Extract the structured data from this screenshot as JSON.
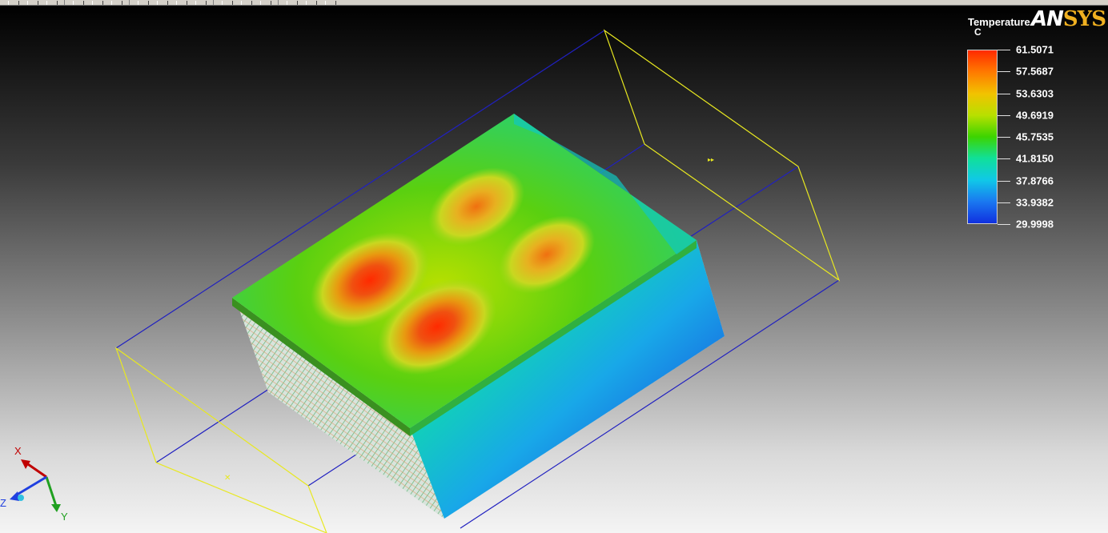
{
  "app": {
    "logo_prefix": "AN",
    "logo_suffix": "SYS",
    "brand_accent": "#f0b020"
  },
  "legend": {
    "title": "Temperature",
    "unit": "C",
    "labels": [
      "61.5071",
      "57.5687",
      "53.6303",
      "49.6919",
      "45.7535",
      "41.8150",
      "37.8766",
      "33.9382",
      "29.9998"
    ],
    "colors": [
      "#ff2a00",
      "#ff7a00",
      "#f2c200",
      "#b8e000",
      "#3cd400",
      "#10e09a",
      "#10c8e8",
      "#1a78f0",
      "#1030e0"
    ]
  },
  "axes": {
    "x_label": "X",
    "y_label": "Y",
    "z_label": "Z",
    "x_color": "#c00000",
    "y_color": "#20a020",
    "z_color": "#2040e0"
  }
}
